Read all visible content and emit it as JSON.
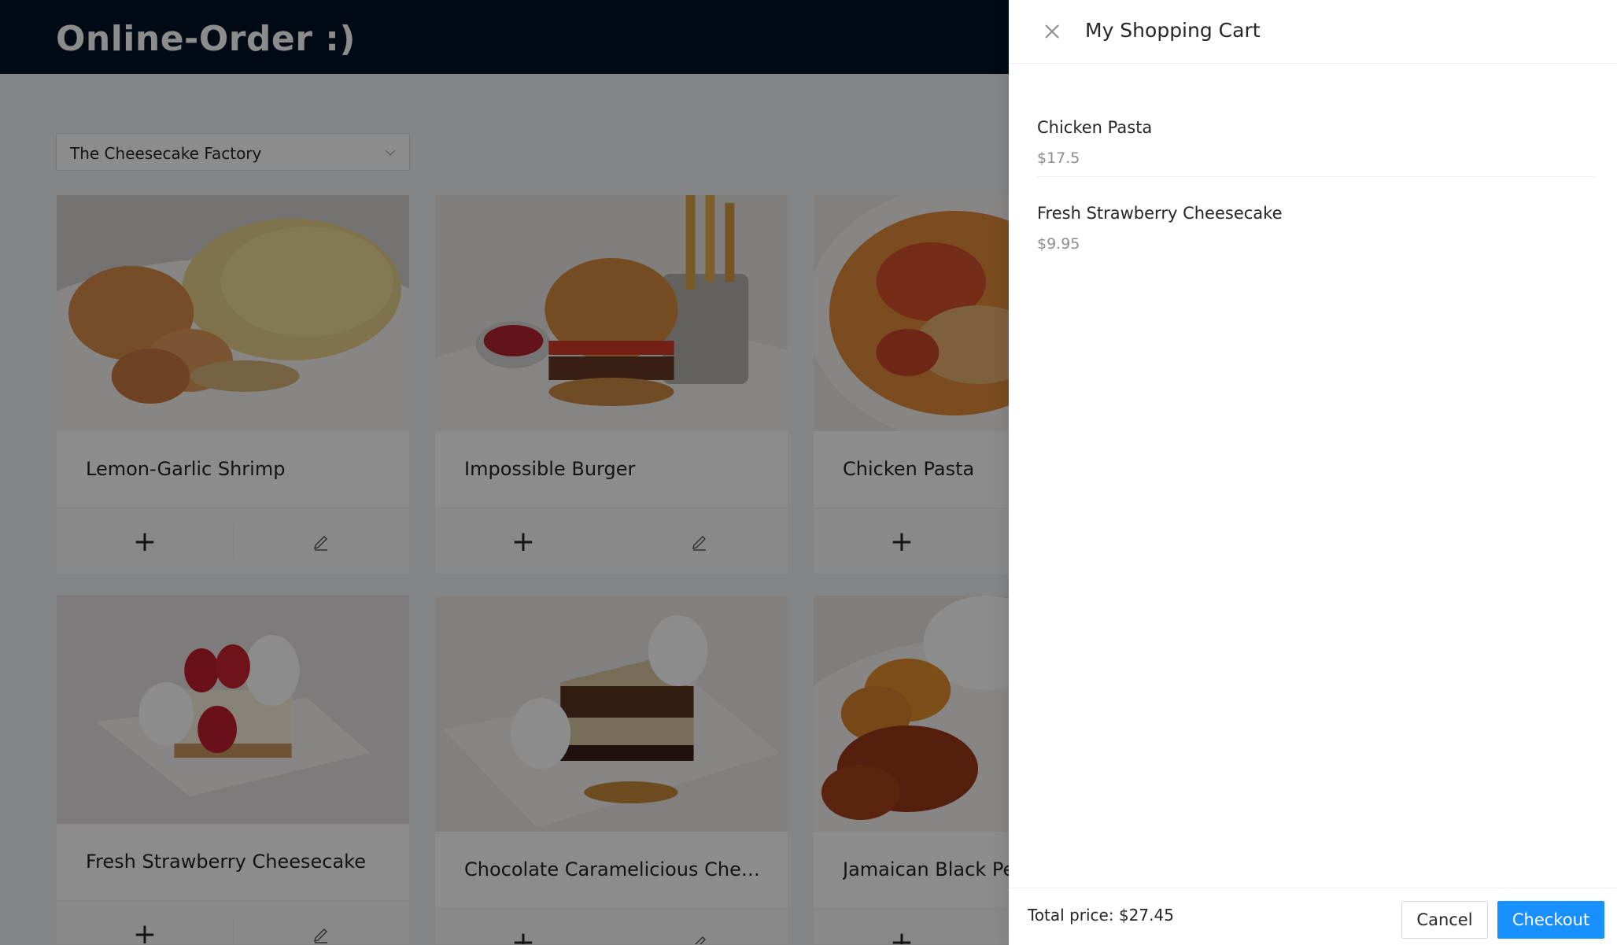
{
  "header": {
    "title": "Online-Order :)"
  },
  "restaurant_select": {
    "value": "The Cheesecake Factory",
    "icon": "chevron-down-icon"
  },
  "menu": {
    "items": [
      {
        "title": "Lemon-Garlic Shrimp",
        "add_label": "+",
        "image": "shrimp-pasta-image"
      },
      {
        "title": "Impossible Burger",
        "add_label": "+",
        "image": "burger-image"
      },
      {
        "title": "Chicken Pasta",
        "add_label": "+",
        "image": "chicken-pasta-image"
      },
      {
        "title": "Fresh Strawberry Cheesecake",
        "add_label": "+",
        "image": "strawberry-cheesecake-image"
      },
      {
        "title": "Chocolate Caramelicious Cheese...",
        "add_label": "+",
        "image": "chocolate-cheesecake-image"
      },
      {
        "title": "Jamaican Black Pep",
        "add_label": "+",
        "image": "jamaican-chicken-image"
      }
    ]
  },
  "cart": {
    "title": "My Shopping Cart",
    "items": [
      {
        "name": "Chicken Pasta",
        "price": "$17.5"
      },
      {
        "name": "Fresh Strawberry Cheesecake",
        "price": "$9.95"
      }
    ],
    "total_label": "Total price: $27.45",
    "cancel_label": "Cancel",
    "checkout_label": "Checkout"
  },
  "colors": {
    "header_bg": "#001529",
    "primary": "#1890ff",
    "mask": "rgba(0,0,0,0.45)"
  }
}
